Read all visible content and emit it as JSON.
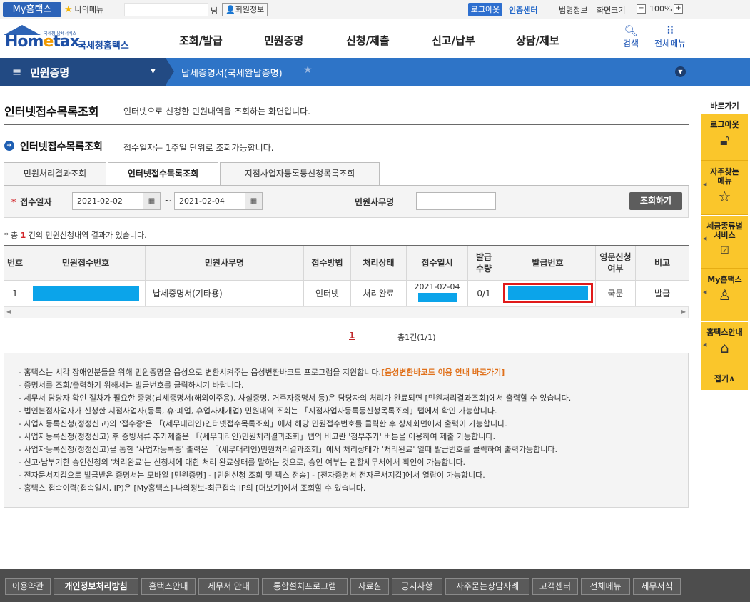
{
  "topbar": {
    "my_hometax": "My홈택스",
    "my_menu": "나의메뉴",
    "nim": "님",
    "member_info": "회원정보",
    "logout": "로그아웃",
    "cert_center": "인증센터",
    "law_info": "법령정보",
    "screen_size": "화면크기",
    "zoom_minus": "−",
    "zoom_value": "100%",
    "zoom_plus": "+"
  },
  "header": {
    "logo_small": "국세청 납세서비스",
    "logo_main_a": "Hom",
    "logo_main_e": "e",
    "logo_main_b": "tax.",
    "logo_kr": "국세청홈택스",
    "nav": [
      "조회/발급",
      "민원증명",
      "신청/제출",
      "신고/납부",
      "상담/제보"
    ],
    "search": "검색",
    "all_menu": "전체메뉴"
  },
  "location": {
    "menu": "민원증명",
    "current": "납세증명서(국세완납증명)"
  },
  "page": {
    "title": "인터넷접수목록조회",
    "description": "인터넷으로 신청한 민원내역을 조회하는 화면입니다.",
    "section_title": "인터넷접수목록조회",
    "section_desc": "접수일자는 1주일 단위로 조회가능합니다."
  },
  "tabs": [
    {
      "label": "민원처리결과조회",
      "active": false
    },
    {
      "label": "인터넷접수목록조회",
      "active": true
    },
    {
      "label": "지점사업자등록등신청목록조회",
      "active": false
    }
  ],
  "search": {
    "date_label": "접수일자",
    "required_mark": "*",
    "from": "2021-02-02",
    "to": "2021-02-04",
    "tilde": "~",
    "name_label": "민원사무명",
    "name_value": "",
    "button": "조회하기"
  },
  "results": {
    "prefix": "* 총 ",
    "count": "1",
    "suffix": " 건의 민원신청내역 결과가 있습니다.",
    "headers": [
      "번호",
      "민원접수번호",
      "민원사무명",
      "접수방법",
      "처리상태",
      "접수일시",
      "발급\n수량",
      "발급번호",
      "영문신청\n여부",
      "비고"
    ],
    "rows": [
      {
        "no": "1",
        "receipt_no": "",
        "name": "납세증명서(기타용)",
        "method": "인터넷",
        "status": "처리완료",
        "date": "2021-02-04",
        "qty": "0/1",
        "issue_no": "",
        "english": "국문",
        "note": "발급"
      }
    ]
  },
  "pagination": {
    "current": "1",
    "total": "총1건(1/1)"
  },
  "notices": [
    "- 홈택스는 시각 장애인분들을 위해 민원증명을 음성으로 변환시켜주는 음성변환바코드 프로그램을 지원합니다.",
    "- 증명서를 조회/출력하기 위해서는 발급번호를 클릭하시기 바랍니다.",
    "- 세무서 담당자 확인 절차가 필요한 증명(납세증명서(해외이주용), 사실증명, 거주자증명서 등)은 담당자의 처리가 완료되면 [민원처리결과조회]에서 출력할 수 있습니다.",
    "- 법인본점사업자가 신청한 지점사업자(등록, 휴·폐업, 휴업자재개업) 민원내역 조회는 「지점사업자등록등신청목록조회」탭에서 확인 가능합니다.",
    "- 사업자등록신청(정정신고)의 '접수증'은 「(세무대리인)인터넷접수목록조회」에서 해당 민원접수번호를 클릭한 후 상세화면에서 출력이 가능합니다.",
    "- 사업자등록신청(정정신고) 후 증빙서류 추가제출은 「(세무대리인)민원처리결과조회」탭의 비고란 '첨부추가' 버튼을 이용하여 제출 가능합니다.",
    "- 사업자등록신청(정정신고)을 통한 '사업자등록증' 출력은 「(세무대리인)민원처리결과조회」에서 처리상태가 '처리완료' 일때 발급번호를 클릭하여 출력가능합니다.",
    "- 신고·납부기한 승인신청의 '처리완료'는 신청서에 대한 처리 완료상태를 말하는 것으로, 승인 여부는 관할세무서에서 확인이 가능합니다.",
    "- 전자문서지갑으로 발급받은 증명서는 모바일 [민원증명] - [민원신청 조회 및 팩스 전송] - [전자증명서 전자문서지갑]에서 열람이 가능합니다.",
    "- 홈택스 접속이력(접속일시, IP)은 [My홈택스]-나의정보-최근접속 IP의 [더보기]에서 조회할 수 있습니다."
  ],
  "notice_link": "[음성변환바코드 이용 안내 바로가기]",
  "quick": {
    "title": "바로가기",
    "items": [
      "로그아웃",
      "자주찾는\n메뉴",
      "세금종류별\n서비스",
      "My홈택스",
      "홈택스안내"
    ],
    "close": "접기∧"
  },
  "footer": [
    "이용약관",
    "개인정보처리방침",
    "홈택스안내",
    "세무서 안내",
    "통합설치프로그램",
    "자료실",
    "공지사항",
    "자주묻는상담사례",
    "고객센터",
    "전체메뉴",
    "세무서식"
  ],
  "colors": {
    "brand_blue": "#2e74c7",
    "brand_dark": "#224a83",
    "quick_yellow": "#fac62b",
    "highlight_red": "#e01a1a",
    "mask_blue": "#0ba4ea"
  }
}
